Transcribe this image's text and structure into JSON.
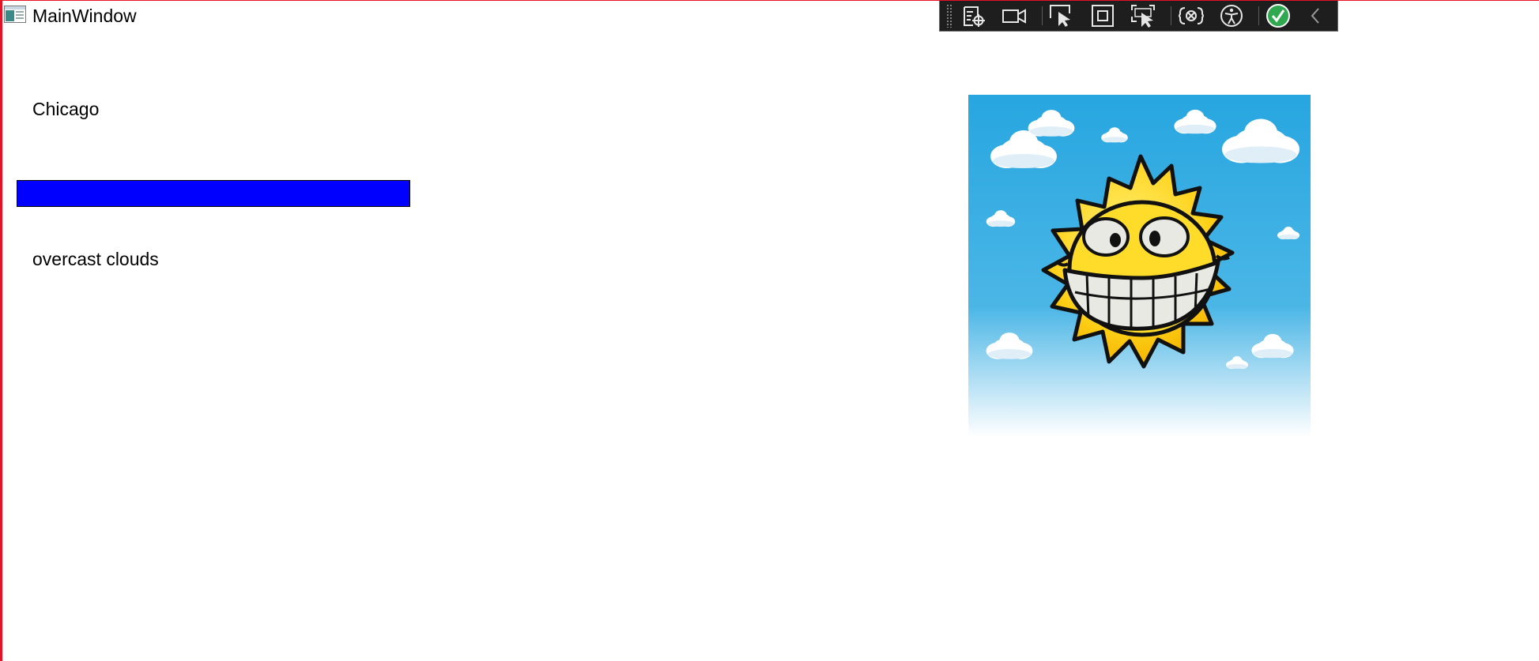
{
  "window": {
    "title": "MainWindow",
    "border_color": "#e81123"
  },
  "debug_toolbar": {
    "buttons": [
      {
        "name": "live-visual-tree-icon"
      },
      {
        "name": "video-camera-icon"
      },
      {
        "name": "select-element-icon"
      },
      {
        "name": "display-layout-adorners-icon"
      },
      {
        "name": "track-focused-element-icon"
      },
      {
        "name": "binding-failures-icon"
      },
      {
        "name": "accessibility-icon"
      },
      {
        "name": "check-circle-icon"
      },
      {
        "name": "collapse-chevron-icon"
      }
    ]
  },
  "weather": {
    "city": "Chicago",
    "temperature_bar_fraction": 1.0,
    "temperature_bar_color": "#0000ff",
    "description": "overcast clouds",
    "image": "smiling-sun-with-clouds"
  }
}
